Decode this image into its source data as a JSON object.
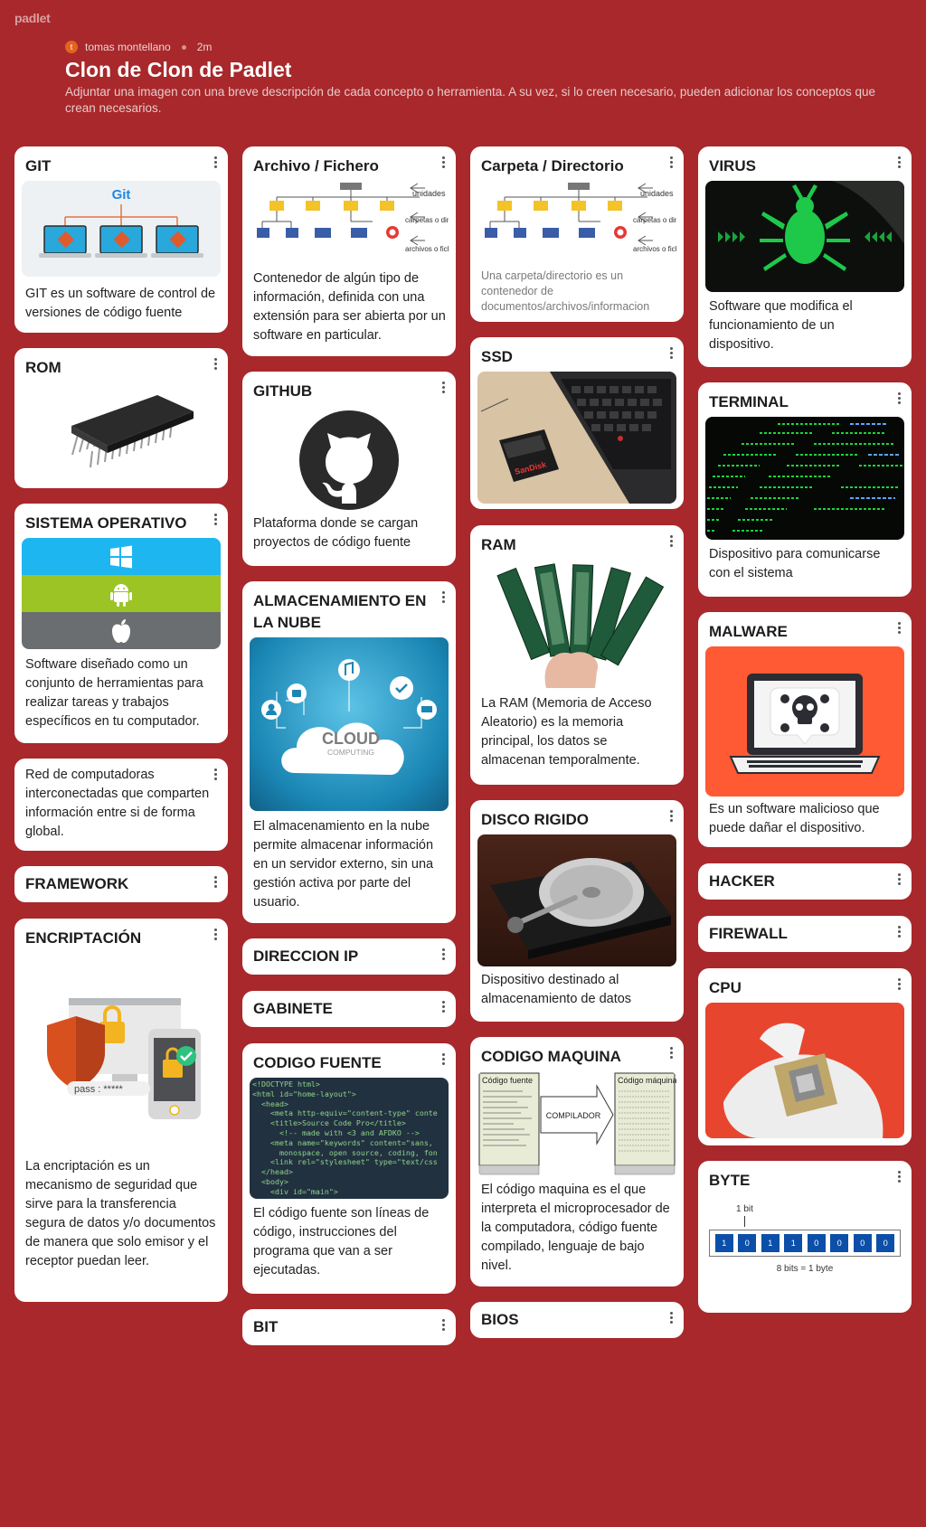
{
  "brand": "padlet",
  "meta": {
    "avatar_letter": "t",
    "author": "tomas montellano",
    "time": "2m"
  },
  "title": "Clon de Clon de Padlet",
  "description": "Adjuntar una imagen con una breve descripción de cada concepto o herramienta. A su vez, si lo creen necesario, pueden adicionar los conceptos que crean necesarios.",
  "colors": {
    "background": "#a8282b",
    "card": "#ffffff"
  },
  "cards": {
    "git": {
      "title": "GIT",
      "image_label": "Git",
      "text": "GIT es un software de control de versiones de código fuente"
    },
    "rom": {
      "title": "ROM"
    },
    "so": {
      "title": "SISTEMA OPERATIVO",
      "text": "Software diseñado como un conjunto de herramientas para realizar tareas y trabajos específicos en tu computador."
    },
    "red": {
      "text": "Red de computadoras interconectadas que comparten información entre si de forma global."
    },
    "framework": {
      "title": "FRAMEWORK"
    },
    "encriptacion": {
      "title": "ENCRIPTACIÓN",
      "image_label": "pass : *****",
      "text": "La encriptación es un mecanismo de seguridad que sirve para la transferencia segura de datos y/o documentos de manera que solo emisor y el receptor puedan leer."
    },
    "archivo": {
      "title": "Archivo / Fichero",
      "diagram_labels": [
        "unidades",
        "carpetas o directorios",
        "archivos o ficheros"
      ],
      "text": "Contenedor de algún tipo de información, definida con una extensión para ser abierta por un software en particular."
    },
    "github": {
      "title": "GITHUB",
      "text": "Plataforma donde se cargan proyectos de código fuente"
    },
    "nube": {
      "title": "ALMACENAMIENTO EN LA NUBE",
      "image_label": "CLOUD",
      "image_sublabel": "COMPUTING",
      "text": "El almacenamiento en la nube permite almacenar información en un servidor externo, sin una gestión activa por parte del usuario."
    },
    "ip": {
      "title": "DIRECCION IP"
    },
    "gabinete": {
      "title": "GABINETE"
    },
    "codigo_fuente": {
      "title": "CODIGO FUENTE",
      "code_lines": [
        "<!DOCTYPE html>",
        "<html id=\"home-layout\">",
        "  <head>",
        "    <meta http-equiv=\"content-type\" conte",
        "    <title>Source Code Pro</title>",
        "      <!-- made with <3 and AFDKO -->",
        "    <meta name=\"keywords\" content=\"sans,",
        "      monospace, open source, coding, fon",
        "    <link rel=\"stylesheet\" type=\"text/css",
        "  </head>",
        "  <body>",
        "    <div id=\"main\">"
      ],
      "text": "El código fuente son líneas de código, instrucciones del programa que van a ser ejecutadas."
    },
    "bit": {
      "title": "BIT"
    },
    "carpeta": {
      "title": "Carpeta / Directorio",
      "diagram_labels": [
        "unidades",
        "carpetas o directorios",
        "archivos o ficheros"
      ],
      "text": "Una carpeta/directorio es un contenedor de documentos/archivos/informacion"
    },
    "ssd": {
      "title": "SSD",
      "image_label": "SanDisk"
    },
    "ram": {
      "title": "RAM",
      "text": "La RAM (Memoria de Acceso Aleatorio) es la memoria principal, los datos se almacenan temporalmente."
    },
    "disco": {
      "title": "DISCO RIGIDO",
      "text": "Dispositivo destinado al almacenamiento de datos"
    },
    "codigo_maquina": {
      "title": "CODIGO MAQUINA",
      "image_labels": [
        "Código fuente",
        "COMPILADOR",
        "Código máquina"
      ],
      "text": "El código maquina es el que interpreta el microprocesador de la computadora, código fuente compilado, lenguaje de bajo nivel."
    },
    "bios": {
      "title": "BIOS"
    },
    "virus": {
      "title": "VIRUS",
      "text": "Software que modifica el funcionamiento de un dispositivo."
    },
    "terminal": {
      "title": "TERMINAL",
      "text": "Dispositivo para comunicarse con el sistema"
    },
    "malware": {
      "title": "MALWARE",
      "text": "Es un software malicioso que puede dañar el dispositivo."
    },
    "hacker": {
      "title": "HACKER"
    },
    "firewall": {
      "title": "FIREWALL"
    },
    "cpu": {
      "title": "CPU"
    },
    "byte": {
      "title": "BYTE",
      "top_label": "1 bit",
      "bits": [
        "1",
        "0",
        "1",
        "1",
        "0",
        "0",
        "0",
        "0"
      ],
      "bottom_label": "8 bits = 1 byte"
    }
  }
}
